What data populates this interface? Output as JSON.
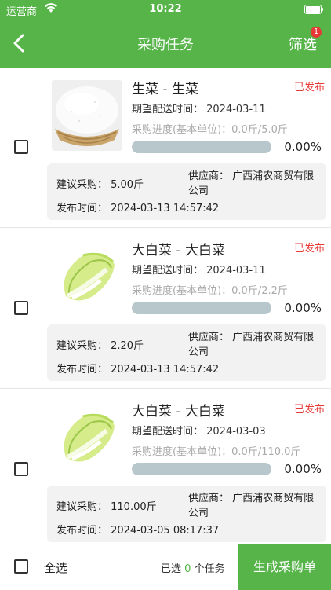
{
  "status_bar": {
    "carrier": "运营商",
    "time": "10:22"
  },
  "nav": {
    "title": "采购任务",
    "filter_label": "筛选",
    "filter_badge": "1"
  },
  "tasks": [
    {
      "name": "生菜 - 生菜",
      "status": "已发布",
      "expect_date": "期望配送时间：  2024-03-11",
      "progress_label": "采购进度(基本单位)：0.0斤/5.0斤",
      "progress_percent": "0.00%",
      "progress_value": 0,
      "suggest": "建议采购：  5.00斤",
      "supplier": "供应商：  广西浦农商贸有限公司",
      "publish_time": "发布时间：  2024-03-13 14:57:42",
      "image_icon": "rice-photo"
    },
    {
      "name": "大白菜 - 大白菜",
      "status": "已发布",
      "expect_date": "期望配送时间：  2024-03-11",
      "progress_label": "采购进度(基本单位)：0.0斤/2.2斤",
      "progress_percent": "0.00%",
      "progress_value": 0,
      "suggest": "建议采购：  2.20斤",
      "supplier": "供应商：  广西浦农商贸有限公司",
      "publish_time": "发布时间：  2024-03-13 14:57:42",
      "image_icon": "napa-cabbage-photo"
    },
    {
      "name": "大白菜 - 大白菜",
      "status": "已发布",
      "expect_date": "期望配送时间：  2024-03-03",
      "progress_label": "采购进度(基本单位)：0.0斤/110.0斤",
      "progress_percent": "0.00%",
      "progress_value": 0,
      "suggest": "建议采购：  110.00斤",
      "supplier": "供应商：  广西浦农商贸有限公司",
      "publish_time": "发布时间：  2024-03-05 08:17:37",
      "image_icon": "napa-cabbage-photo"
    }
  ],
  "bottom": {
    "select_all": "全选",
    "selected_prefix": "已选",
    "selected_count": "0",
    "selected_suffix": "个任务",
    "generate": "生成采购单"
  },
  "colors": {
    "primary": "#56b449",
    "status_red": "#e53935",
    "progress_track": "#b8c7cc"
  }
}
